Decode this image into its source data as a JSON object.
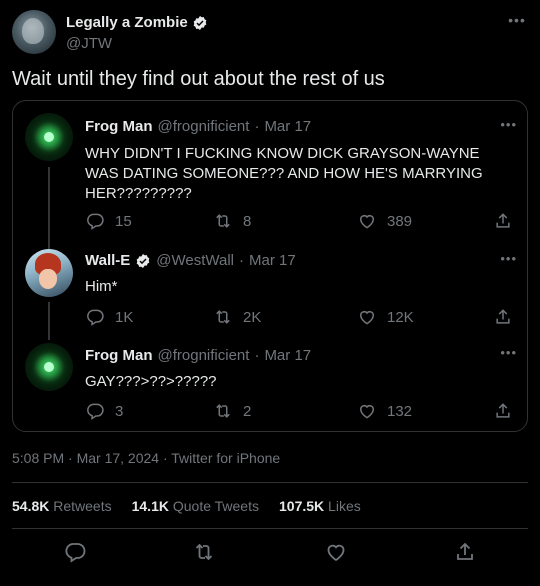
{
  "author": {
    "display_name": "Legally a Zombie",
    "handle": "@JTW",
    "verified": true
  },
  "tweet_text": "Wait until they find out about the rest of us",
  "quoted_thread": [
    {
      "name": "Frog Man",
      "handle": "@frognificient",
      "date": "Mar 17",
      "text": "WHY DIDN'T I FUCKING KNOW DICK GRAYSON-WAYNE WAS DATING SOMEONE??? AND HOW HE'S MARRYING HER?????????",
      "replies": "15",
      "retweets": "8",
      "likes": "389",
      "verified": false
    },
    {
      "name": "Wall-E",
      "handle": "@WestWall",
      "date": "Mar 17",
      "text": "Him*",
      "replies": "1K",
      "retweets": "2K",
      "likes": "12K",
      "verified": true
    },
    {
      "name": "Frog Man",
      "handle": "@frognificient",
      "date": "Mar 17",
      "text": "GAY???>??>?????",
      "replies": "3",
      "retweets": "2",
      "likes": "132",
      "verified": false
    }
  ],
  "timestamp": "5:08 PM · Mar 17, 2024 · Twitter for iPhone",
  "stats": {
    "retweets_count": "54.8K",
    "retweets_label": "Retweets",
    "quote_count": "14.1K",
    "quote_label": "Quote Tweets",
    "likes_count": "107.5K",
    "likes_label": "Likes"
  },
  "colors": {
    "background": "#000000",
    "text": "#e7e9ea",
    "muted": "#71767b",
    "verified": "#e7e9ea",
    "border": "#2f3336"
  },
  "icons": [
    "more-icon",
    "verified-icon",
    "reply-icon",
    "retweet-icon",
    "like-icon",
    "share-icon"
  ]
}
